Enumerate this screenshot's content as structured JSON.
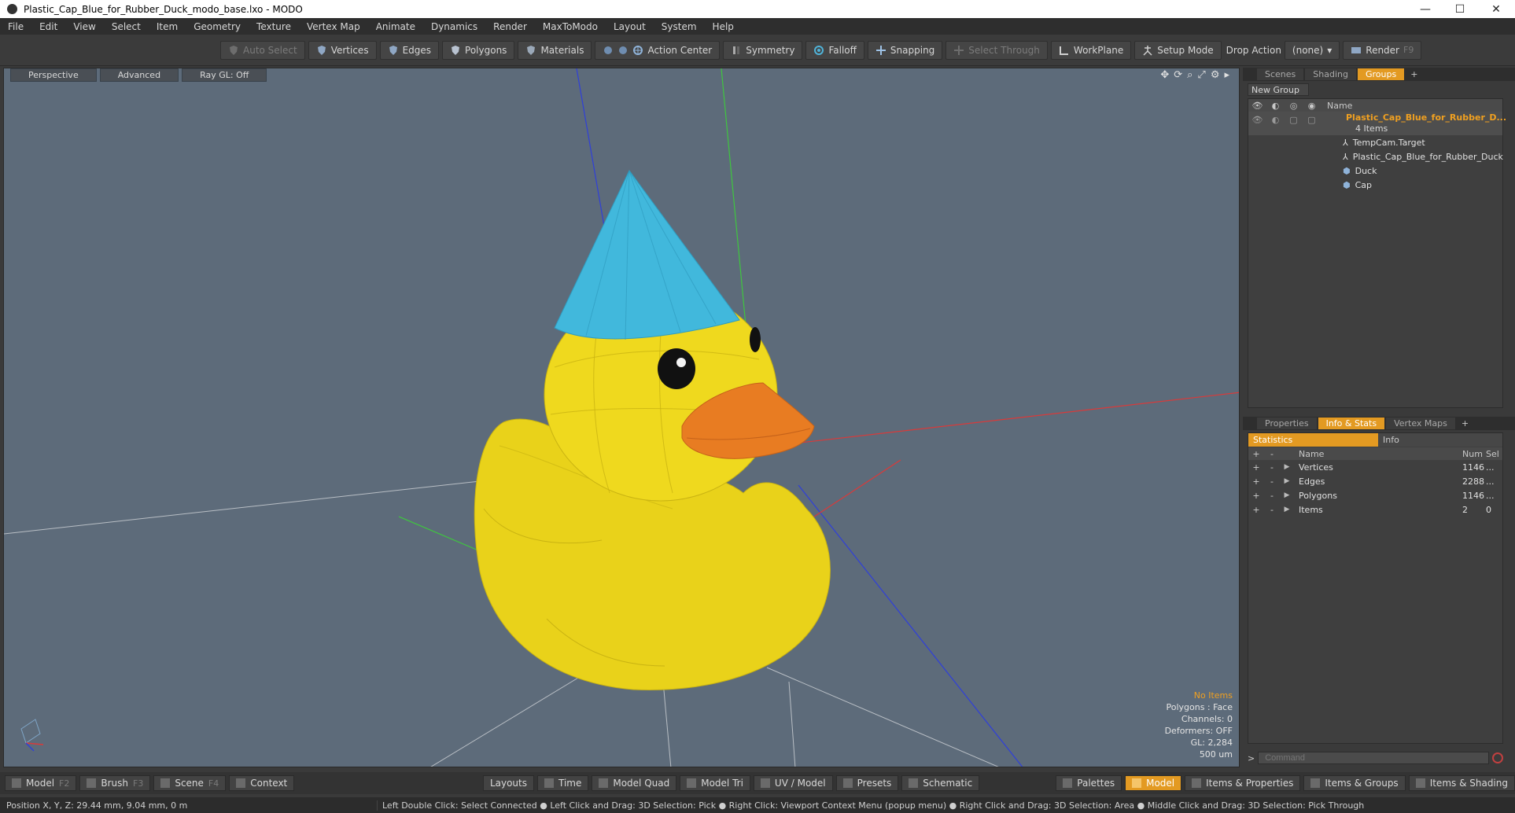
{
  "window": {
    "title": "Plastic_Cap_Blue_for_Rubber_Duck_modo_base.lxo - MODO",
    "minimize": "—",
    "maximize": "☐",
    "close": "✕"
  },
  "menu": [
    "File",
    "Edit",
    "View",
    "Select",
    "Item",
    "Geometry",
    "Texture",
    "Vertex Map",
    "Animate",
    "Dynamics",
    "Render",
    "MaxToModo",
    "Layout",
    "System",
    "Help"
  ],
  "toolbar": {
    "auto_select": "Auto Select",
    "vertices": "Vertices",
    "edges": "Edges",
    "polygons": "Polygons",
    "materials": "Materials",
    "action_center": "Action Center",
    "symmetry": "Symmetry",
    "falloff": "Falloff",
    "snapping": "Snapping",
    "select_through": "Select Through",
    "workplane": "WorkPlane",
    "setup_mode": "Setup Mode",
    "drop_action": "Drop Action",
    "drop_value": "(none)",
    "render": "Render",
    "render_key": "F9"
  },
  "viewport": {
    "tabs": [
      "Perspective",
      "Advanced",
      "Ray GL: Off"
    ],
    "stats": {
      "no_items": "No Items",
      "polygons": "Polygons : Face",
      "channels": "Channels: 0",
      "deformers": "Deformers: OFF",
      "gl": "GL: 2,284",
      "scale": "500 um"
    }
  },
  "groups_panel": {
    "tabs": [
      "Scenes",
      "Shading",
      "Groups"
    ],
    "active_tab": "Groups",
    "new_group": "New Group",
    "name_header": "Name",
    "group_name": "Plastic_Cap_Blue_for_Rubber_D...",
    "group_count": "4 Items",
    "items": [
      "TempCam.Target",
      "Plastic_Cap_Blue_for_Rubber_Duck",
      "Duck",
      "Cap"
    ]
  },
  "stats_panel": {
    "tabs": [
      "Properties",
      "Info & Stats",
      "Vertex Maps"
    ],
    "active_tab": "Info & Stats",
    "subtabs": [
      "Statistics",
      "Info"
    ],
    "headers": {
      "name": "Name",
      "num": "Num",
      "sel": "Sel"
    },
    "rows": [
      {
        "name": "Vertices",
        "num": "1146",
        "sel": "..."
      },
      {
        "name": "Edges",
        "num": "2288",
        "sel": "..."
      },
      {
        "name": "Polygons",
        "num": "1146",
        "sel": "..."
      },
      {
        "name": "Items",
        "num": "2",
        "sel": "0"
      }
    ]
  },
  "command": {
    "placeholder": "Command",
    "prompt": ">"
  },
  "bottombar": {
    "left": [
      {
        "label": "Model",
        "key": "F2"
      },
      {
        "label": "Brush",
        "key": "F3"
      },
      {
        "label": "Scene",
        "key": "F4"
      },
      {
        "label": "Context",
        "key": ""
      }
    ],
    "middle": [
      "Layouts",
      "Time",
      "Model Quad",
      "Model Tri",
      "UV / Model",
      "Presets",
      "Schematic"
    ],
    "right": [
      "Palettes",
      "Model",
      "Items & Properties",
      "Items & Groups",
      "Items & Shading"
    ]
  },
  "status": {
    "position": "Position X, Y, Z:  29.44 mm, 9.04 mm, 0 m",
    "hint": "Left Double Click: Select Connected ● Left Click and Drag: 3D Selection: Pick ● Right Click: Viewport Context Menu (popup menu) ● Right Click and Drag: 3D Selection: Area ● Middle Click and Drag: 3D Selection: Pick Through"
  },
  "colors": {
    "accent": "#e39a22",
    "viewport_bg": "#5d6b7a",
    "duck": "#f2d81c",
    "cap": "#41b8dc",
    "beak": "#e87c22"
  }
}
